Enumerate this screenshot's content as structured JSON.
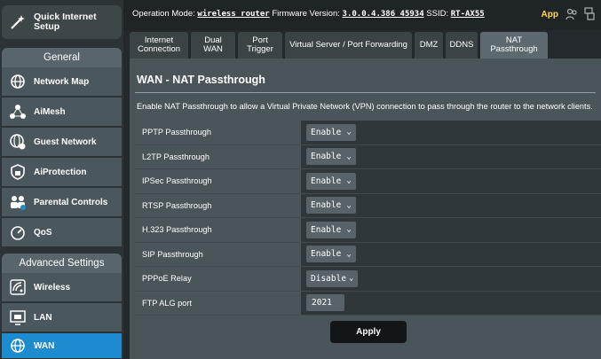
{
  "sidebar": {
    "quick_setup": "Quick Internet Setup",
    "group_general": "General",
    "general_items": [
      {
        "label": "Network Map"
      },
      {
        "label": "AiMesh"
      },
      {
        "label": "Guest Network"
      },
      {
        "label": "AiProtection"
      },
      {
        "label": "Parental Controls"
      },
      {
        "label": "QoS"
      }
    ],
    "group_advanced": "Advanced Settings",
    "advanced_items": [
      {
        "label": "Wireless"
      },
      {
        "label": "LAN"
      },
      {
        "label": "WAN"
      }
    ]
  },
  "topbar": {
    "opmode_label": "Operation Mode:",
    "opmode_value": "wireless router",
    "firmware_label": "Firmware Version:",
    "firmware_value": "3.0.0.4.386_45934",
    "ssid_label": "SSID:",
    "ssid_value": "RT-AX55",
    "app_label": "App"
  },
  "tabs": [
    {
      "label": "Internet Connection"
    },
    {
      "label": "Dual WAN"
    },
    {
      "label": "Port Trigger"
    },
    {
      "label": "Virtual Server / Port Forwarding"
    },
    {
      "label": "DMZ"
    },
    {
      "label": "DDNS"
    },
    {
      "label": "NAT Passthrough"
    }
  ],
  "page": {
    "title": "WAN - NAT Passthrough",
    "description": "Enable NAT Passthrough to allow a Virtual Private Network (VPN) connection to pass through the router to the network clients.",
    "rows": [
      {
        "label": "PPTP Passthrough",
        "value": "Enable"
      },
      {
        "label": "L2TP Passthrough",
        "value": "Enable"
      },
      {
        "label": "IPSec Passthrough",
        "value": "Enable"
      },
      {
        "label": "RTSP Passthrough",
        "value": "Enable"
      },
      {
        "label": "H.323 Passthrough",
        "value": "Enable"
      },
      {
        "label": "SIP Passthrough",
        "value": "Enable"
      },
      {
        "label": "PPPoE Relay",
        "value": "Disable"
      },
      {
        "label": "FTP ALG port",
        "value": "2021"
      }
    ],
    "apply_label": "Apply"
  },
  "colors": {
    "accent": "#1d8bd0",
    "app": "#ffd84a"
  }
}
